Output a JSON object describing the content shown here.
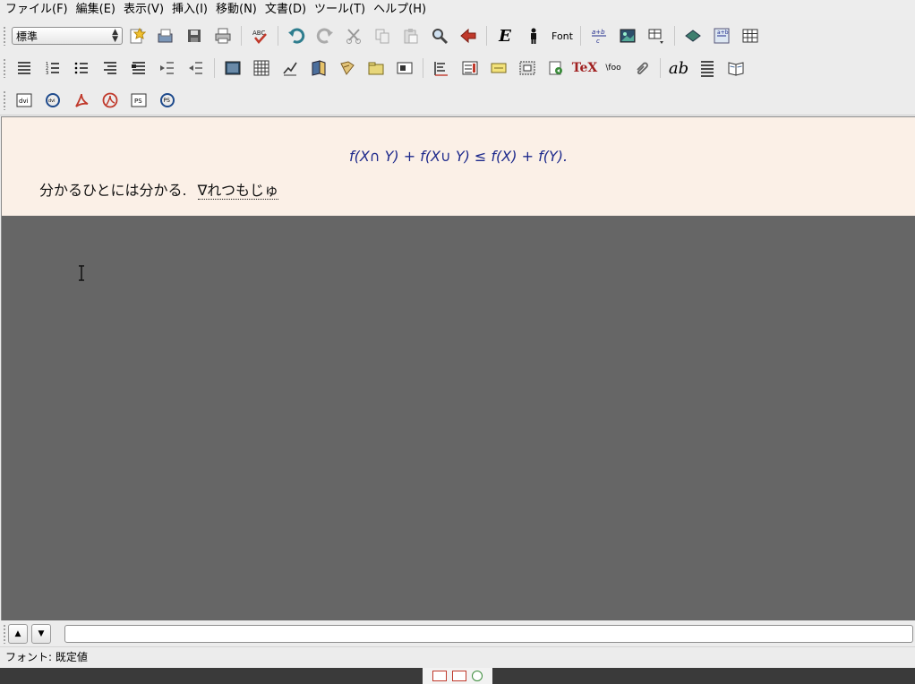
{
  "menu": {
    "items": [
      {
        "label": "ファイル(F)"
      },
      {
        "label": "編集(E)"
      },
      {
        "label": "表示(V)"
      },
      {
        "label": "挿入(I)"
      },
      {
        "label": "移動(N)"
      },
      {
        "label": "文書(D)"
      },
      {
        "label": "ツール(T)"
      },
      {
        "label": "ヘルプ(H)"
      }
    ]
  },
  "toolbar": {
    "layout_value": "標準",
    "font_label": "Font",
    "tex_label": "TeX",
    "foo_label": "\\foo",
    "ab_label": "ab",
    "e_label": "E",
    "spell_label": "ABC",
    "ps_label": "PS",
    "dvi_label": "dvi"
  },
  "document": {
    "math": "f(X∩ Y) + f(X∪ Y) ≤ f(X) + f(Y).",
    "text": "分かるひとには分かる.",
    "preedit": "∇れつもじゅ"
  },
  "statusbar": {
    "text": "フォント: 既定値"
  },
  "colors": {
    "page_background": "#fbf0e7",
    "workarea_background": "#666666",
    "math_color": "#1e2a8c"
  }
}
